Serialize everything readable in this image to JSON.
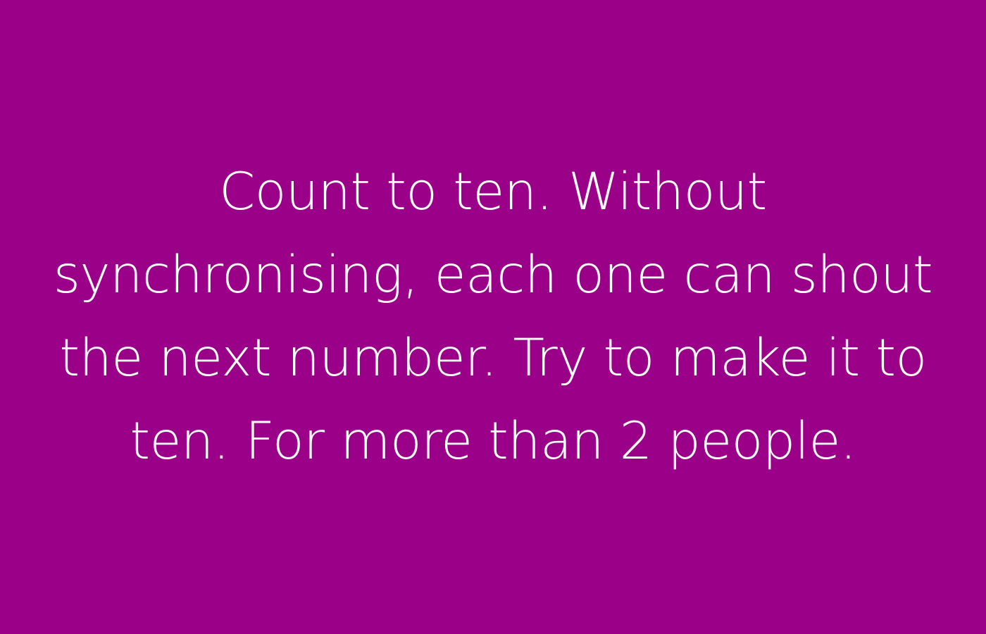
{
  "card": {
    "background_color": "#9b0088",
    "text_color": "#ffffff",
    "lines": [
      "Count to ten. Without",
      "synchronising, each one can shout",
      "the next number. Try to make it to",
      "ten. For more than 2 people."
    ]
  }
}
